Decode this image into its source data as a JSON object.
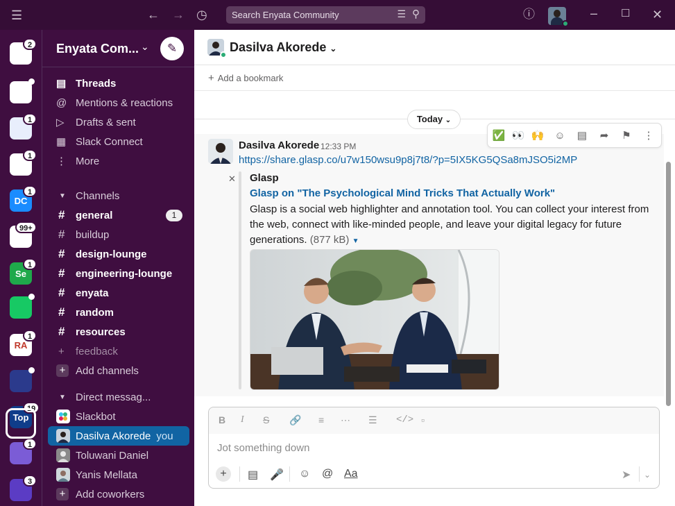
{
  "titlebar": {
    "search_placeholder": "Search Enyata Community"
  },
  "workspaces": [
    {
      "initials": "",
      "badge": "2",
      "bg": "#ffffff"
    },
    {
      "initials": "",
      "badge": "",
      "dot": true,
      "bg": "#ffffff"
    },
    {
      "initials": "",
      "badge": "1",
      "bg": "#e8eefc"
    },
    {
      "initials": "",
      "badge": "1",
      "bg": "#ffffff"
    },
    {
      "initials": "DC",
      "badge": "1",
      "bg": "#1a8cff"
    },
    {
      "initials": "",
      "badge": "99+",
      "bg": "#ffffff"
    },
    {
      "initials": "Se",
      "badge": "1",
      "bg": "#1fa94b"
    },
    {
      "initials": "",
      "badge": "",
      "dot": true,
      "bg": "#17c964"
    },
    {
      "initials": "RA",
      "badge": "1",
      "bg": "#ffffff"
    },
    {
      "initials": "",
      "badge": "",
      "dot": true,
      "bg": "#2b3a8c"
    },
    {
      "initials": "Top",
      "badge": "19",
      "bg": "#0f3d8a"
    },
    {
      "initials": "",
      "badge": "1",
      "bg": "#7b5cd6"
    },
    {
      "initials": "",
      "badge": "3",
      "bg": "#5b3cc4"
    }
  ],
  "sidebar": {
    "workspace_name": "Enyata Com...",
    "nav": [
      {
        "label": "Threads",
        "icon": "threads-icon",
        "bold": true
      },
      {
        "label": "Mentions & reactions",
        "icon": "at-icon",
        "bold": false
      },
      {
        "label": "Drafts & sent",
        "icon": "send-icon",
        "bold": false
      },
      {
        "label": "Slack Connect",
        "icon": "building-icon",
        "bold": false
      },
      {
        "label": "More",
        "icon": "more-icon",
        "bold": false
      }
    ],
    "channels_header": "Channels",
    "channels": [
      {
        "name": "general",
        "bold": true,
        "count": "1"
      },
      {
        "name": "buildup",
        "bold": false,
        "count": ""
      },
      {
        "name": "design-lounge",
        "bold": true,
        "count": ""
      },
      {
        "name": "engineering-lounge",
        "bold": true,
        "count": ""
      },
      {
        "name": "enyata",
        "bold": true,
        "count": ""
      },
      {
        "name": "random",
        "bold": true,
        "count": ""
      },
      {
        "name": "resources",
        "bold": true,
        "count": ""
      },
      {
        "name": "feedback",
        "bold": false,
        "count": "",
        "muted": true
      }
    ],
    "add_channels": "Add channels",
    "dm_header": "Direct messag...",
    "dms": [
      {
        "name": "Slackbot",
        "suffix": ""
      },
      {
        "name": "Dasilva Akorede",
        "suffix": "you",
        "active": true
      },
      {
        "name": "Toluwani Daniel",
        "suffix": ""
      },
      {
        "name": "Yanis Mellata",
        "suffix": ""
      }
    ],
    "add_coworkers": "Add coworkers"
  },
  "channel": {
    "name": "Dasilva Akorede",
    "bookmark_label": "Add a bookmark"
  },
  "day_divider": "Today",
  "message": {
    "author": "Dasilva Akorede",
    "time": "12:33 PM",
    "link": "https://share.glasp.co/u7w150wsu9p8j7t8/?p=5IX5KG5QSa8mJSO5i2MP",
    "unfurl": {
      "site": "Glasp",
      "title": "Glasp on \"The Psychological Mind Tricks That Actually Work\"",
      "description": "Glasp is a social web highlighter and annotation tool. You can collect your interest from the web, connect with like-minded people, and leave your digital legacy for future generations.",
      "size": "(877 kB)"
    }
  },
  "hover_actions": [
    "✅",
    "👀",
    "🙌",
    "add-reaction-icon",
    "reply-thread-icon",
    "share-icon",
    "bookmark-icon",
    "more-actions-icon"
  ],
  "composer": {
    "placeholder": "Jot something down",
    "format_label": "Aa"
  },
  "colors": {
    "aubergine": "#3f0e40",
    "titlebar": "#350d36",
    "active_blue": "#1164a3",
    "link_blue": "#1264a3",
    "online_green": "#2bac76"
  }
}
